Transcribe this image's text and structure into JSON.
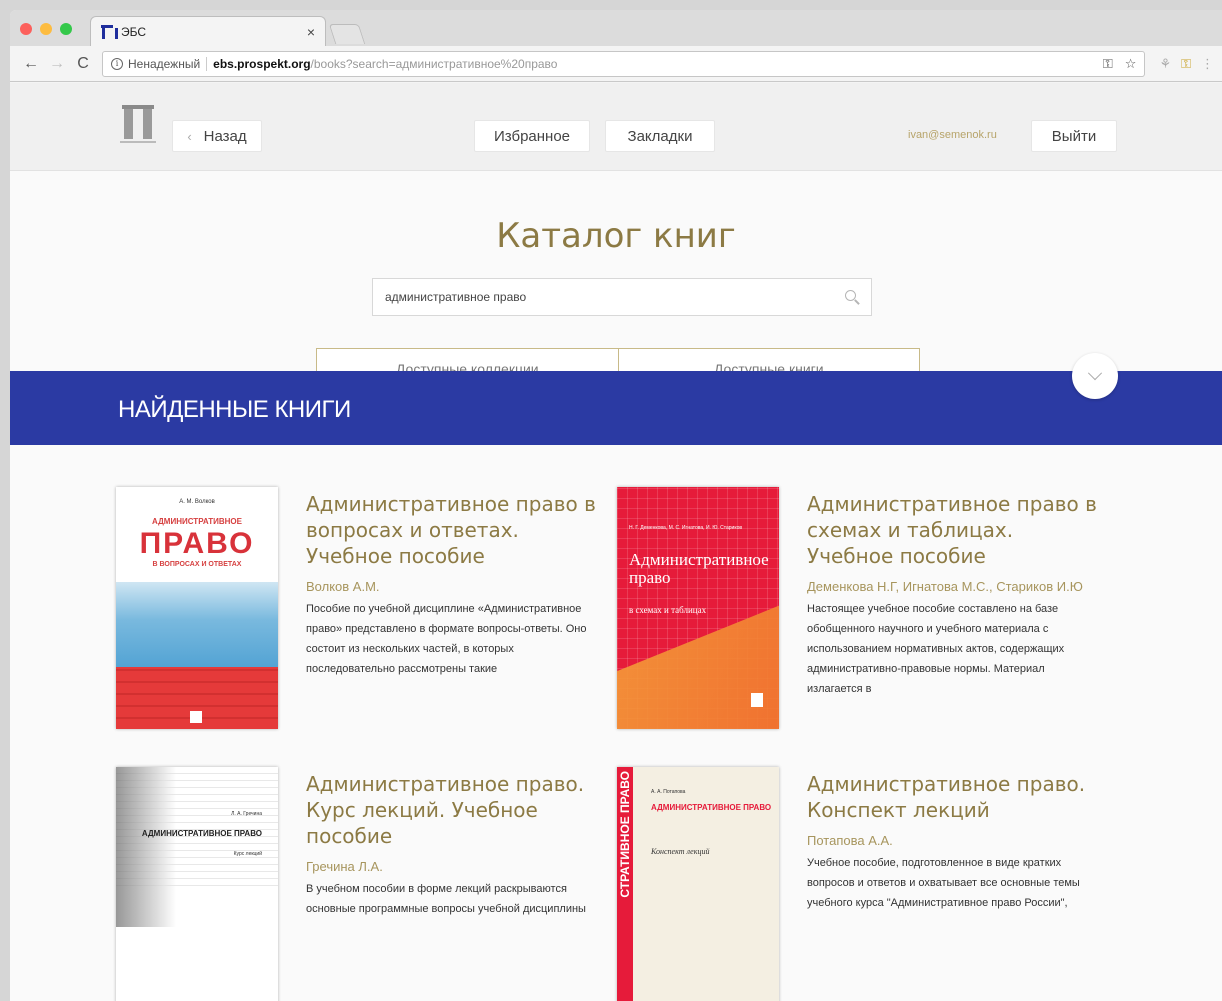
{
  "browser": {
    "tab_title": "ЭБС",
    "tab_close": "×",
    "nav": {
      "back": "←",
      "forward": "→",
      "reload": "C"
    },
    "omnibox": {
      "info": "i",
      "security_label": "Ненадежный",
      "host": "ebs.prospekt.org",
      "path": "/books?search=административное%20право",
      "key_icon": "⚿",
      "star_icon": "☆"
    },
    "extensions": [
      "⚘",
      "⚿",
      "⋮"
    ]
  },
  "header": {
    "back_label": "Назад",
    "back_chevron": "‹",
    "favorites_label": "Избранное",
    "bookmarks_label": "Закладки",
    "user_email": "ivan@semenok.ru",
    "logout_label": "Выйти"
  },
  "catalog": {
    "title": "Каталог книг",
    "search_value": "административное право",
    "toggles": [
      "Доступные коллекции",
      "Доступные книги"
    ]
  },
  "banner": {
    "title": "НАЙДЕННЫЕ КНИГИ"
  },
  "books": [
    {
      "title": "Административное право в вопросах и ответах. Учебное пособие",
      "author": "Волков А.М.",
      "description": "Пособие по учебной дисциплине «Административное право» представлено в формате вопросы-ответы. Оно состоит из нескольких частей, в которых последовательно рассмотрены такие",
      "cover": {
        "author": "А. М. Волков",
        "line1": "АДМИНИСТРАТИВНОЕ",
        "line2": "ПРАВО",
        "line3": "В ВОПРОСАХ И ОТВЕТАХ"
      }
    },
    {
      "title": "Административное право в схемах и таблицах. Учебное пособие",
      "author": "Деменкова Н.Г, Игнатова М.С., Стариков И.Ю",
      "description": "Настоящее учебное пособие составлено на базе обобщенного научного и учебного материала с использованием нормативных актов, содержащих административно-правовые нормы. Материал излагается в",
      "cover": {
        "authors": "Н. Г. Деменкова, М. С. Игнатова, И. Ю. Стариков",
        "title": "Административное право",
        "subtitle": "в схемах и таблицах"
      }
    },
    {
      "title": "Административное право. Курс лекций. Учебное пособие",
      "author": "Гречина Л.А.",
      "description": "В учебном пособии в форме лекций раскрываются основные программные вопросы учебной дисциплины",
      "cover": {
        "author": "Л. А. Гречина",
        "title": "АДМИНИСТРАТИВНОЕ ПРАВО",
        "subtitle": "Курс лекций"
      }
    },
    {
      "title": "Административное право. Конспект лекций",
      "author": "Потапова А.А.",
      "description": "Учебное пособие, подготовленное в виде кратких вопросов и ответов и охватывает все основные темы учебного курса \"Административное право России\",",
      "cover": {
        "spine": "СТРАТИВНОЕ ПРАВО",
        "author": "А. А. Потапова",
        "title": "АДМИНИСТРАТИВНОЕ ПРАВО",
        "subtitle": "Конспект лекций"
      }
    }
  ]
}
